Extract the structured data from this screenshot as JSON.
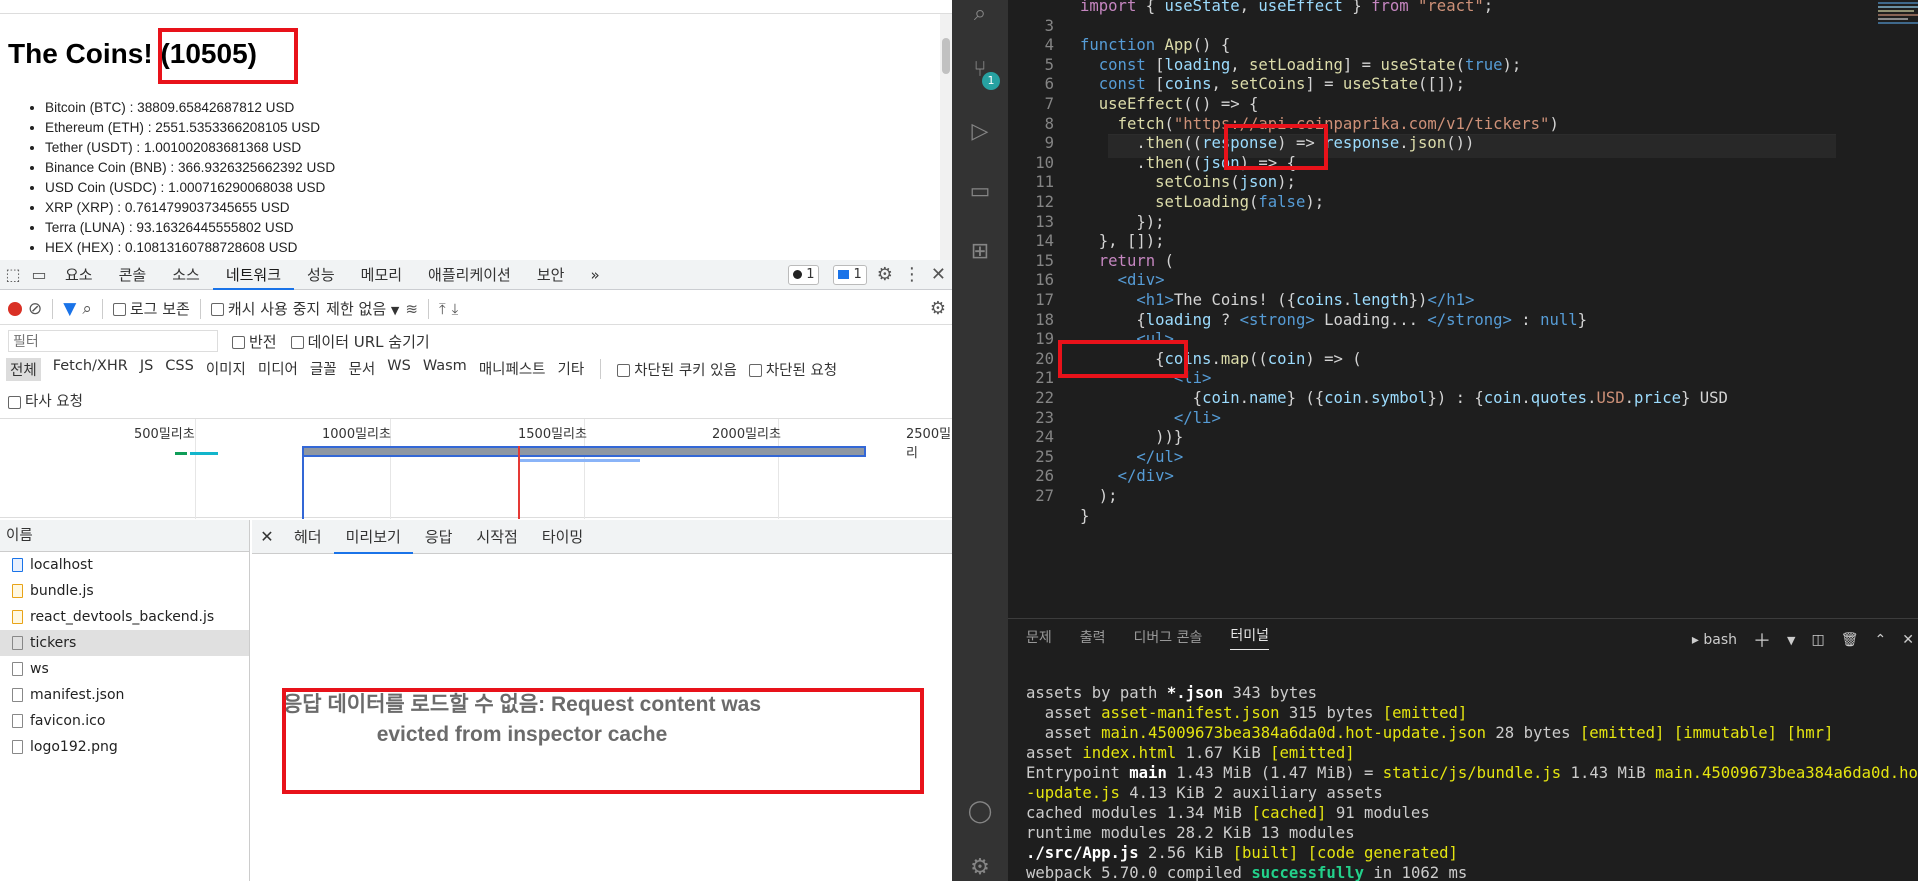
{
  "page": {
    "heading_prefix": "The Coins! ",
    "heading_count": "(10505)",
    "coins": [
      "Bitcoin (BTC) : 38809.65842687812 USD",
      "Ethereum (ETH) : 2551.5353366208105 USD",
      "Tether (USDT) : 1.001002083681368 USD",
      "Binance Coin (BNB) : 366.9326325662392 USD",
      "USD Coin (USDC) : 1.000716290068038 USD",
      "XRP (XRP) : 0.7614799037345655 USD",
      "Terra (LUNA) : 93.16326445555802 USD",
      "HEX (HEX) : 0.10813160788728608 USD"
    ]
  },
  "devtools": {
    "tabs": [
      "요소",
      "콘솔",
      "소스",
      "네트워크",
      "성능",
      "메모리",
      "애플리케이션",
      "보안"
    ],
    "more": "»",
    "badge_errors": "1",
    "badge_messages": "1",
    "toolbar": {
      "preserve_log": "로그 보존",
      "disable_cache": "캐시 사용 중지",
      "throttle": "제한 없음"
    },
    "filter": {
      "placeholder": "필터",
      "invert": "반전",
      "hide_data_urls": "데이터 URL 숨기기"
    },
    "types": [
      "전체",
      "Fetch/XHR",
      "JS",
      "CSS",
      "이미지",
      "미디어",
      "글꼴",
      "문서",
      "WS",
      "Wasm",
      "매니페스트",
      "기타"
    ],
    "blocked_cookies": "차단된 쿠키 있음",
    "blocked_requests": "차단된 요청",
    "third_party": "타사 요청",
    "timeline_labels": [
      "500밀리초",
      "1000밀리초",
      "1500밀리초",
      "2000밀리초",
      "2500밀리"
    ],
    "name_header": "이름",
    "requests": [
      "localhost",
      "bundle.js",
      "react_devtools_backend.js",
      "tickers",
      "ws",
      "manifest.json",
      "favicon.ico",
      "logo192.png"
    ],
    "detail_tabs": [
      "헤더",
      "미리보기",
      "응답",
      "시작점",
      "타이밍"
    ],
    "error_message": "응답 데이터를 로드할 수 없음: Request content was evicted from inspector cache"
  },
  "editor": {
    "lines": [
      {
        "n": "",
        "html": "<span class='kw'>import</span> { <span class='var'>useState</span>, <span class='var'>useEffect</span> } <span class='kw'>from</span> <span class='str'>\"react\"</span>;"
      },
      {
        "n": "3",
        "html": ""
      },
      {
        "n": "4",
        "html": "<span class='fnk'>function</span> <span class='fn'>App</span>() {"
      },
      {
        "n": "5",
        "html": "  <span class='fnk'>const</span> [<span class='var'>loading</span>, <span class='fn'>setLoading</span>] = <span class='fn'>useState</span>(<span class='fnk'>true</span>);"
      },
      {
        "n": "6",
        "html": "  <span class='fnk'>const</span> [<span class='var'>coins</span>, <span class='fn'>setCoins</span>] = <span class='fn'>useState</span>([]);"
      },
      {
        "n": "7",
        "html": "  <span class='fn'>useEffect</span>(() => {"
      },
      {
        "n": "8",
        "html": "    <span class='fn'>fetch</span>(<span class='str'>\"https://api.coinpaprika.com/v1/tickers\"</span>)"
      },
      {
        "n": "9",
        "html": "      .<span class='fn'>then</span>((<span class='var'>response</span>) => <span class='var'>response</span>.<span class='fn'>json</span>())"
      },
      {
        "n": "10",
        "html": "      .<span class='fn'>then</span>((<span class='var'>json</span>) => {"
      },
      {
        "n": "11",
        "html": "        <span class='fn'>setCoins</span>(<span class='var'>json</span>);"
      },
      {
        "n": "12",
        "html": "        <span class='fn'>setLoading</span>(<span class='fnk'>false</span>);"
      },
      {
        "n": "13",
        "html": "      });"
      },
      {
        "n": "14",
        "html": "  }, []);"
      },
      {
        "n": "15",
        "html": "  <span class='kw'>return</span> ("
      },
      {
        "n": "16",
        "html": "    <span class='tag'>&lt;div&gt;</span>"
      },
      {
        "n": "17",
        "html": "      <span class='tag'>&lt;h1&gt;</span>The Coins! ({<span class='var'>coins</span>.<span class='var'>length</span>})<span class='tag'>&lt;/h1&gt;</span>"
      },
      {
        "n": "18",
        "html": "      {<span class='var'>loading</span> ? <span class='tag'>&lt;strong&gt;</span> Loading... <span class='tag'>&lt;/strong&gt;</span> : <span class='fnk'>null</span>}"
      },
      {
        "n": "19",
        "html": "      <span class='tag'>&lt;ul&gt;</span>"
      },
      {
        "n": "20",
        "html": "        {<span class='var'>coins</span>.<span class='fn'>map</span>((<span class='var'>coin</span>) => ("
      },
      {
        "n": "21",
        "html": "          <span class='tag'>&lt;li&gt;</span>"
      },
      {
        "n": "22",
        "html": "            {<span class='var'>coin</span>.<span class='var'>name</span>} ({<span class='var'>coin</span>.<span class='var'>symbol</span>}) : {<span class='var'>coin</span>.<span class='var'>quotes</span>.<span class='str'>USD</span>.<span class='var'>price</span>} USD"
      },
      {
        "n": "23",
        "html": "          <span class='tag'>&lt;/li&gt;</span>"
      },
      {
        "n": "24",
        "html": "        ))}"
      },
      {
        "n": "25",
        "html": "      <span class='tag'>&lt;/ul&gt;</span>"
      },
      {
        "n": "26",
        "html": "    <span class='tag'>&lt;/div&gt;</span>"
      },
      {
        "n": "27",
        "html": "  );"
      },
      {
        "n": "",
        "html": "}"
      }
    ]
  },
  "panel": {
    "tabs": [
      "문제",
      "출력",
      "디버그 콘솔",
      "터미널"
    ],
    "shell": "bash",
    "terminal": [
      "assets by path <span class='bw'>*.json</span> 343 bytes",
      "  asset <span class='y'>asset-manifest.json</span> 315 bytes <span class='y'>[emitted]</span>",
      "  asset <span class='y'>main.45009673bea384a6da0d.hot-update.json</span> 28 bytes <span class='y'>[emitted] [immutable] [hmr]</span>",
      "asset <span class='y'>index.html</span> 1.67 KiB <span class='y'>[emitted]</span>",
      "Entrypoint <span class='bw'>main</span> 1.43 MiB (1.47 MiB) = <span class='y'>static/js/bundle.js</span> 1.43 MiB <span class='y'>main.45009673bea384a6da0d.hot</span>",
      "<span class='y'>-update.js</span> 4.13 KiB 2 auxiliary assets",
      "cached modules 1.34 MiB <span class='y'>[cached]</span> 91 modules",
      "runtime modules 28.2 KiB 13 modules",
      "<span class='bw'>./src/App.js</span> 2.56 KiB <span class='y'>[built] [code generated]</span>",
      "webpack 5.70.0 compiled <span class='bgr'>successfully</span> in 1062 ms"
    ]
  }
}
